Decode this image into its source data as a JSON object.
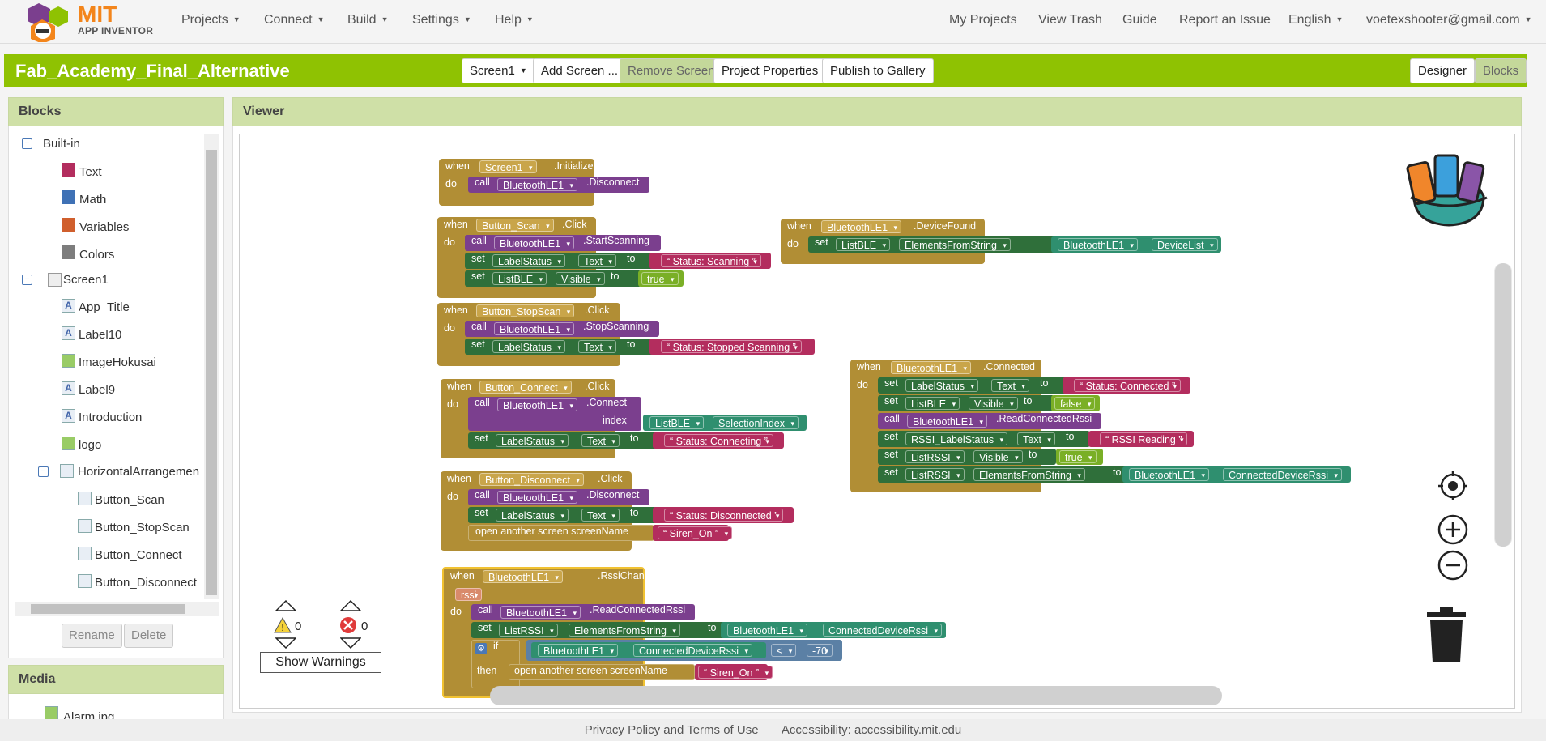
{
  "nav": {
    "logo_mit": "MIT",
    "logo_sub": "APP INVENTOR",
    "items": [
      "Projects",
      "Connect",
      "Build",
      "Settings",
      "Help"
    ],
    "right": [
      "My Projects",
      "View Trash",
      "Guide",
      "Report an Issue",
      "English",
      "voetexshooter@gmail.com"
    ]
  },
  "toolbar": {
    "project_title": "Fab_Academy_Final_Alternative",
    "screen_select": "Screen1",
    "add_screen": "Add Screen ...",
    "remove_screen": "Remove Screen",
    "project_properties": "Project Properties",
    "publish": "Publish to Gallery",
    "designer": "Designer",
    "blocks": "Blocks"
  },
  "blocks_panel": {
    "title": "Blocks",
    "builtin": "Built-in",
    "builtin_items": [
      {
        "label": "Text",
        "color": "#b32d5e"
      },
      {
        "label": "Math",
        "color": "#3f71b5"
      },
      {
        "label": "Variables",
        "color": "#d05f2d"
      },
      {
        "label": "Colors",
        "color": "#7d7d7d"
      }
    ],
    "screen": "Screen1",
    "components": [
      "App_Title",
      "Label10",
      "ImageHokusai",
      "Label9",
      "Introduction",
      "logo"
    ],
    "arrangement": "HorizontalArrangemen",
    "arrangement_children": [
      "Button_Scan",
      "Button_StopScan",
      "Button_Connect",
      "Button_Disconnect"
    ],
    "rename": "Rename",
    "delete": "Delete"
  },
  "media_panel": {
    "title": "Media",
    "items": [
      "Alarm.jpg"
    ]
  },
  "viewer": {
    "title": "Viewer",
    "warnings_count": "0",
    "errors_count": "0",
    "show_warnings": "Show Warnings"
  },
  "block_text": {
    "when": "when",
    "do": "do",
    "call": "call",
    "set": "set",
    "to": "to",
    "if": "if",
    "then": "then",
    "index": "index",
    "screen1": "Screen1",
    "initialize": ".Initialize",
    "ble": "BluetoothLE1",
    "disconnect": ".Disconnect",
    "btn_scan": "Button_Scan",
    "click": ".Click",
    "start_scanning": ".StartScanning",
    "label_status": "LabelStatus",
    "text_prop": "Text",
    "status_scanning": "Status: Scanning",
    "list_ble": "ListBLE",
    "visible": "Visible",
    "true": "true",
    "false": "false",
    "btn_stopscan": "Button_StopScan",
    "stop_scanning": ".StopScanning",
    "status_stopped": "Status: Stopped Scanning",
    "btn_connect": "Button_Connect",
    "connect": ".Connect",
    "selection_index": "SelectionIndex",
    "status_connecting": "Status: Connecting",
    "btn_disconnect": "Button_Disconnect",
    "status_disconnected": "Status: Disconnected",
    "open_screen": "open another screen  screenName",
    "siren_on": "Siren_On",
    "rssi_changed": ".RssiChanged",
    "rssi": "rssi",
    "read_rssi": ".ReadConnectedRssi",
    "list_rssi": "ListRSSI",
    "elements_from_string": "ElementsFromString",
    "connected_device_rssi": "ConnectedDeviceRssi",
    "lt": "<",
    "minus70": "-70",
    "device_found": ".DeviceFound",
    "device_list": "DeviceList",
    "connected": ".Connected",
    "status_connected": "Status: Connected",
    "rssi_label_status": "RSSI_LabelStatus",
    "rssi_reading": "RSSI Reading"
  },
  "footer": {
    "privacy": "Privacy Policy and Terms of Use",
    "accessibility_label": "Accessibility:",
    "accessibility_link": "accessibility.mit.edu"
  }
}
